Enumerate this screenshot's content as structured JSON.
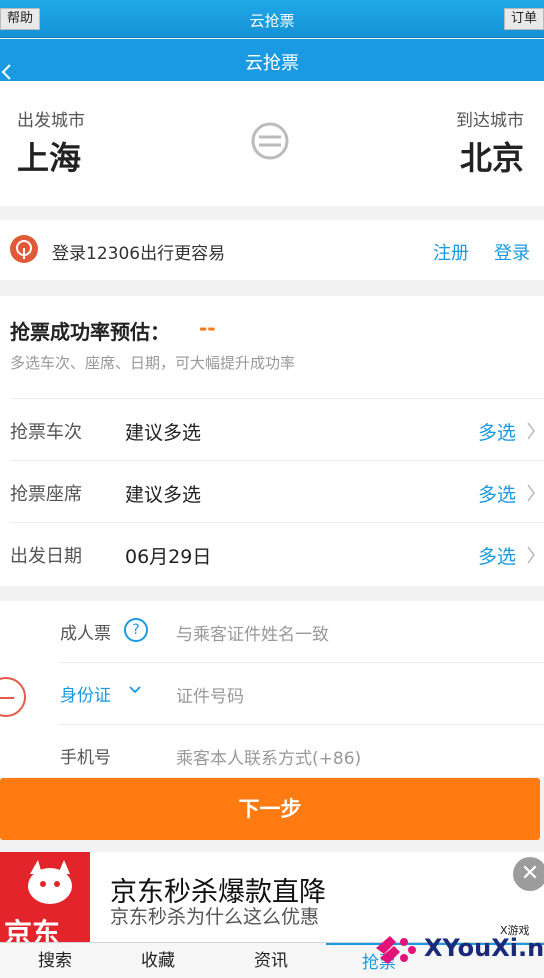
{
  "system_bar": {
    "title": "云抢票",
    "left_button": "帮助",
    "right_button": "订单"
  },
  "nav": {
    "title": "云抢票",
    "back_icon": "chevron-left-icon"
  },
  "cities": {
    "from_label": "出发城市",
    "from_value": "上海",
    "to_label": "到达城市",
    "to_value": "北京",
    "swap_icon": "swap-icon"
  },
  "login": {
    "text": "登录12306出行更容易",
    "register": "注册",
    "login": "登录",
    "icon": "train-logo-icon"
  },
  "estimate": {
    "title": "抢票成功率预估：",
    "value": "--",
    "subtitle": "多选车次、座席、日期，可大幅提升成功率",
    "rows": [
      {
        "label": "抢票车次",
        "value": "建议多选",
        "action": "多选"
      },
      {
        "label": "抢票座席",
        "value": "建议多选",
        "action": "多选"
      },
      {
        "label": "出发日期",
        "value": "06月29日",
        "action": "多选"
      }
    ]
  },
  "passenger": {
    "type_label": "成人票",
    "name_placeholder": "与乘客证件姓名一致",
    "id_type": "身份证",
    "id_placeholder": "证件号码",
    "phone_label": "手机号",
    "phone_placeholder": "乘客本人联系方式(+86)",
    "help_glyph": "?"
  },
  "next_button": "下一步",
  "ad": {
    "headline": "京东秒杀爆款直降",
    "subline": "京东秒杀为什么这么优惠",
    "logo_text": "京东",
    "close_glyph": "✕"
  },
  "tabs": [
    {
      "label": "搜索"
    },
    {
      "label": "收藏"
    },
    {
      "label": "资讯"
    },
    {
      "label": "抢票"
    }
  ],
  "watermark": {
    "brand": "XYouXi.net",
    "small": "X游戏"
  },
  "colors": {
    "accent": "#1a9ae2",
    "primary_button": "#ff7a10",
    "estimate_value": "#f07a1a"
  }
}
